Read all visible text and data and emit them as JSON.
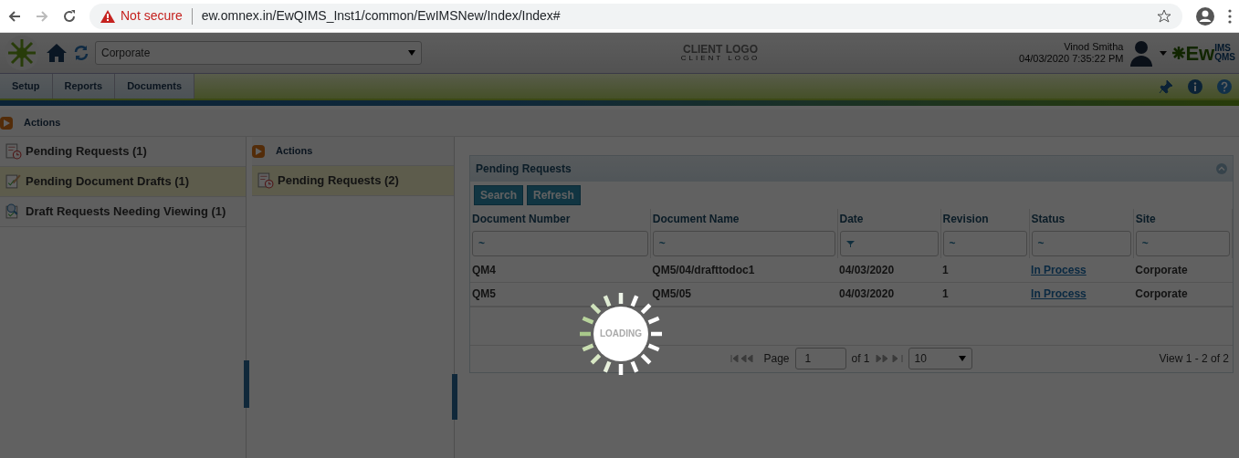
{
  "browser": {
    "security": "Not secure",
    "url": "ew.omnex.in/EwQIMS_Inst1/common/EwIMSNew/Index/Index#"
  },
  "header": {
    "site_select": "Corporate",
    "client_logo": "CLIENT LOGO",
    "client_logo_sub": "CLIENT LOGO",
    "user": "Vinod Smitha",
    "datetime": "04/03/2020 7:35:22 PM",
    "brand": "Ew",
    "brand_sup": "IMS",
    "brand_sub": "QMS"
  },
  "menu": [
    "Setup",
    "Reports",
    "Documents"
  ],
  "breadcrumb": "Actions",
  "left_items": [
    {
      "label": "Pending Requests (1)",
      "selected": false,
      "kind": "request"
    },
    {
      "label": "Pending Document Drafts (1)",
      "selected": true,
      "kind": "draft"
    },
    {
      "label": "Draft Requests Needing Viewing (1)",
      "selected": false,
      "kind": "review"
    }
  ],
  "middle": {
    "breadcrumb": "Actions",
    "items": [
      {
        "label": "Pending Requests (2)",
        "selected": true,
        "kind": "request"
      }
    ]
  },
  "grid": {
    "title": "Pending Requests",
    "buttons": [
      "Search",
      "Refresh"
    ],
    "columns": [
      {
        "label": "Document Number",
        "kind": "text",
        "filter": "~"
      },
      {
        "label": "Document Name",
        "kind": "text",
        "filter": "~"
      },
      {
        "label": "Date",
        "kind": "date"
      },
      {
        "label": "Revision",
        "kind": "text",
        "filter": "~"
      },
      {
        "label": "Status",
        "kind": "link",
        "filter": "~"
      },
      {
        "label": "Site",
        "kind": "text",
        "filter": "~"
      }
    ],
    "rows": [
      [
        "QM4",
        "QM5/04/drafttodoc1",
        "04/03/2020",
        "1",
        "In Process",
        "Corporate"
      ],
      [
        "QM5",
        "QM5/05",
        "04/03/2020",
        "1",
        "In Process",
        "Corporate"
      ]
    ],
    "pager": {
      "page_label": "Page",
      "page": "1",
      "of": "of 1",
      "page_size": "10",
      "view": "View 1 - 2 of 2"
    }
  },
  "loading": "LOADING"
}
